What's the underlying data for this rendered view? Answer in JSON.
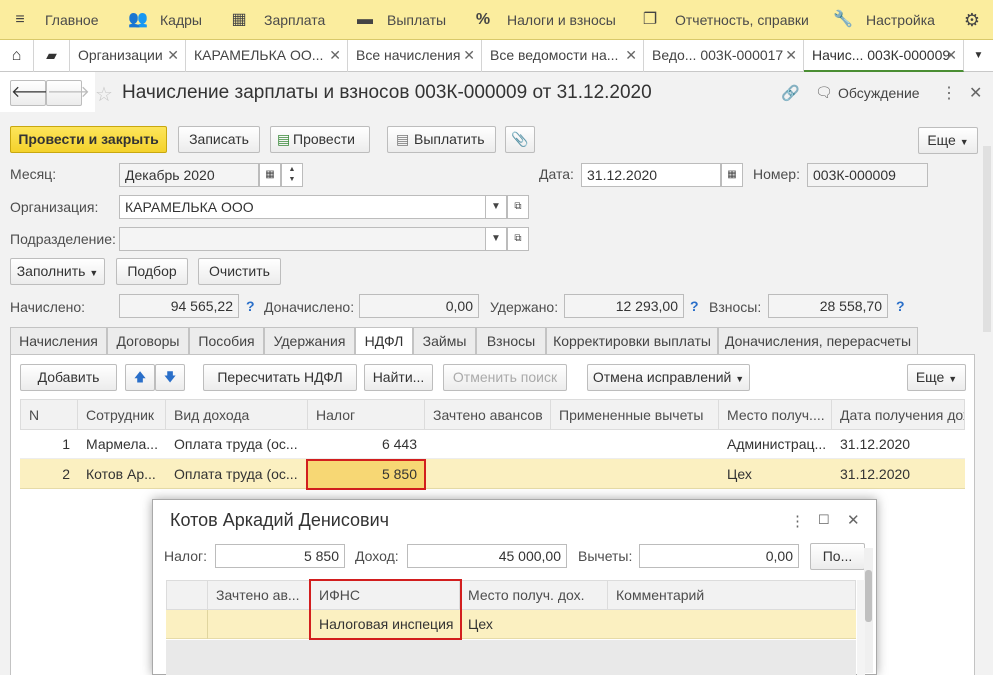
{
  "topnav": {
    "items": [
      {
        "label": "Главное",
        "icon": "menu-icon"
      },
      {
        "label": "Кадры",
        "icon": "people-icon"
      },
      {
        "label": "Зарплата",
        "icon": "calculator-icon"
      },
      {
        "label": "Выплаты",
        "icon": "wallet-icon"
      },
      {
        "label": "Налоги и взносы",
        "icon": "percent-icon"
      },
      {
        "label": "Отчетность, справки",
        "icon": "report-icon"
      },
      {
        "label": "Настройка",
        "icon": "wrench-icon"
      }
    ]
  },
  "tabs": [
    {
      "label": "Организации"
    },
    {
      "label": "КАРАМЕЛЬКА ОО..."
    },
    {
      "label": "Все начисления"
    },
    {
      "label": "Все ведомости на..."
    },
    {
      "label": "Ведо...    003К-000017"
    },
    {
      "label": "Начис... 003К-000009",
      "active": true
    }
  ],
  "doc": {
    "title": "Начисление зарплаты и взносов 003К-000009 от 31.12.2020",
    "discussion": "Обсуждение"
  },
  "toolbar": {
    "post_close": "Провести и закрыть",
    "save": "Записать",
    "post": "Провести",
    "pay": "Выплатить",
    "more": "Еще"
  },
  "fields": {
    "month_label": "Месяц:",
    "month_value": "Декабрь 2020",
    "date_label": "Дата:",
    "date_value": "31.12.2020",
    "number_label": "Номер:",
    "number_value": "003К-000009",
    "org_label": "Организация:",
    "org_value": "КАРАМЕЛЬКА ООО",
    "dept_label": "Подразделение:",
    "dept_value": ""
  },
  "actions": {
    "fill": "Заполнить",
    "select": "Подбор",
    "clear": "Очистить"
  },
  "totals": {
    "accrued_label": "Начислено:",
    "accrued": "94 565,22",
    "extra_label": "Доначислено:",
    "extra": "0,00",
    "withheld_label": "Удержано:",
    "withheld": "12 293,00",
    "contrib_label": "Взносы:",
    "contrib": "28 558,70",
    "help": "?"
  },
  "form_tabs": [
    {
      "label": "Начисления"
    },
    {
      "label": "Договоры"
    },
    {
      "label": "Пособия"
    },
    {
      "label": "Удержания"
    },
    {
      "label": "НДФЛ",
      "active": true
    },
    {
      "label": "Займы"
    },
    {
      "label": "Взносы"
    },
    {
      "label": "Корректировки выплаты"
    },
    {
      "label": "Доначисления, перерасчеты"
    }
  ],
  "ndfl_toolbar": {
    "add": "Добавить",
    "recalc": "Пересчитать НДФЛ",
    "find": "Найти...",
    "cancel_search": "Отменить поиск",
    "undo_fixes": "Отмена исправлений",
    "more": "Еще"
  },
  "table": {
    "columns": [
      "N",
      "Сотрудник",
      "Вид дохода",
      "Налог",
      "Зачтено авансов",
      "Примененные вычеты",
      "Место получ....",
      "Дата получения дох"
    ],
    "rows": [
      {
        "n": "1",
        "employee": "Мармела...",
        "income": "Оплата труда (ос...",
        "tax": "6 443",
        "advances": "",
        "deductions": "",
        "place": "Администрац...",
        "date": "31.12.2020"
      },
      {
        "n": "2",
        "employee": "Котов Ар...",
        "income": "Оплата труда (ос...",
        "tax": "5 850",
        "advances": "",
        "deductions": "",
        "place": "Цех",
        "date": "31.12.2020"
      }
    ]
  },
  "modal": {
    "title": "Котов Аркадий Денисович",
    "tax_label": "Налог:",
    "tax_value": "5 850",
    "income_label": "Доход:",
    "income_value": "45 000,00",
    "deductions_label": "Вычеты:",
    "deductions_value": "0,00",
    "pick": "По...",
    "columns": [
      "Зачтено ав...",
      "ИФНС",
      "Место получ. дох.",
      "Комментарий"
    ],
    "rows": [
      {
        "advances": "",
        "ifns": "Налоговая инспеция",
        "place": "Цех",
        "comment": ""
      }
    ]
  },
  "colors": {
    "accent_yellow": "#f4d22c",
    "highlight_row": "#fbf0c1",
    "red_frame": "#d21e1e",
    "top_bar": "#fbed9e"
  }
}
